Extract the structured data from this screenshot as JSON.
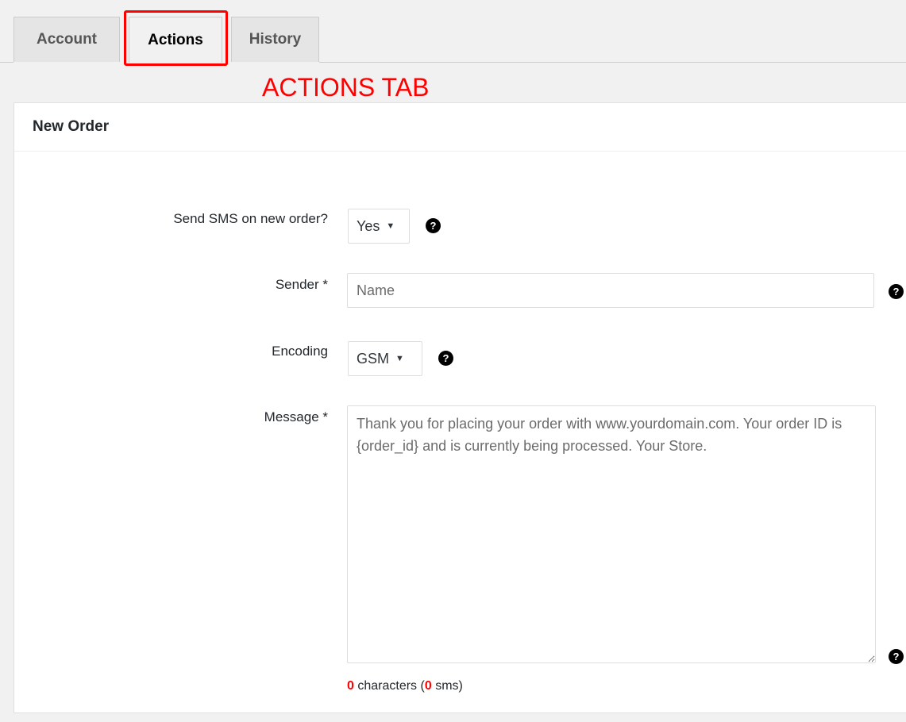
{
  "tabs": [
    {
      "label": "Account"
    },
    {
      "label": "Actions"
    },
    {
      "label": "History"
    }
  ],
  "annotation": "ACTIONS TAB",
  "panel": {
    "title": "New Order"
  },
  "form": {
    "send_sms": {
      "label": "Send SMS on new order?",
      "value": "Yes"
    },
    "sender": {
      "label": "Sender *",
      "placeholder": "Name"
    },
    "encoding": {
      "label": "Encoding",
      "value": "GSM"
    },
    "message": {
      "label": "Message *",
      "placeholder": "Thank you for placing your order with www.yourdomain.com. Your order ID is {order_id} and is currently being processed. Your Store."
    },
    "counter": {
      "characters": "0",
      "characters_text": "characters (",
      "sms": "0",
      "sms_text": "sms)"
    }
  },
  "help_glyph": "?",
  "caret_glyph": "▼",
  "colors": {
    "highlight": "#ff0000",
    "tab_active_bg": "#f1f1f1",
    "tab_bg": "#e5e5e5"
  }
}
